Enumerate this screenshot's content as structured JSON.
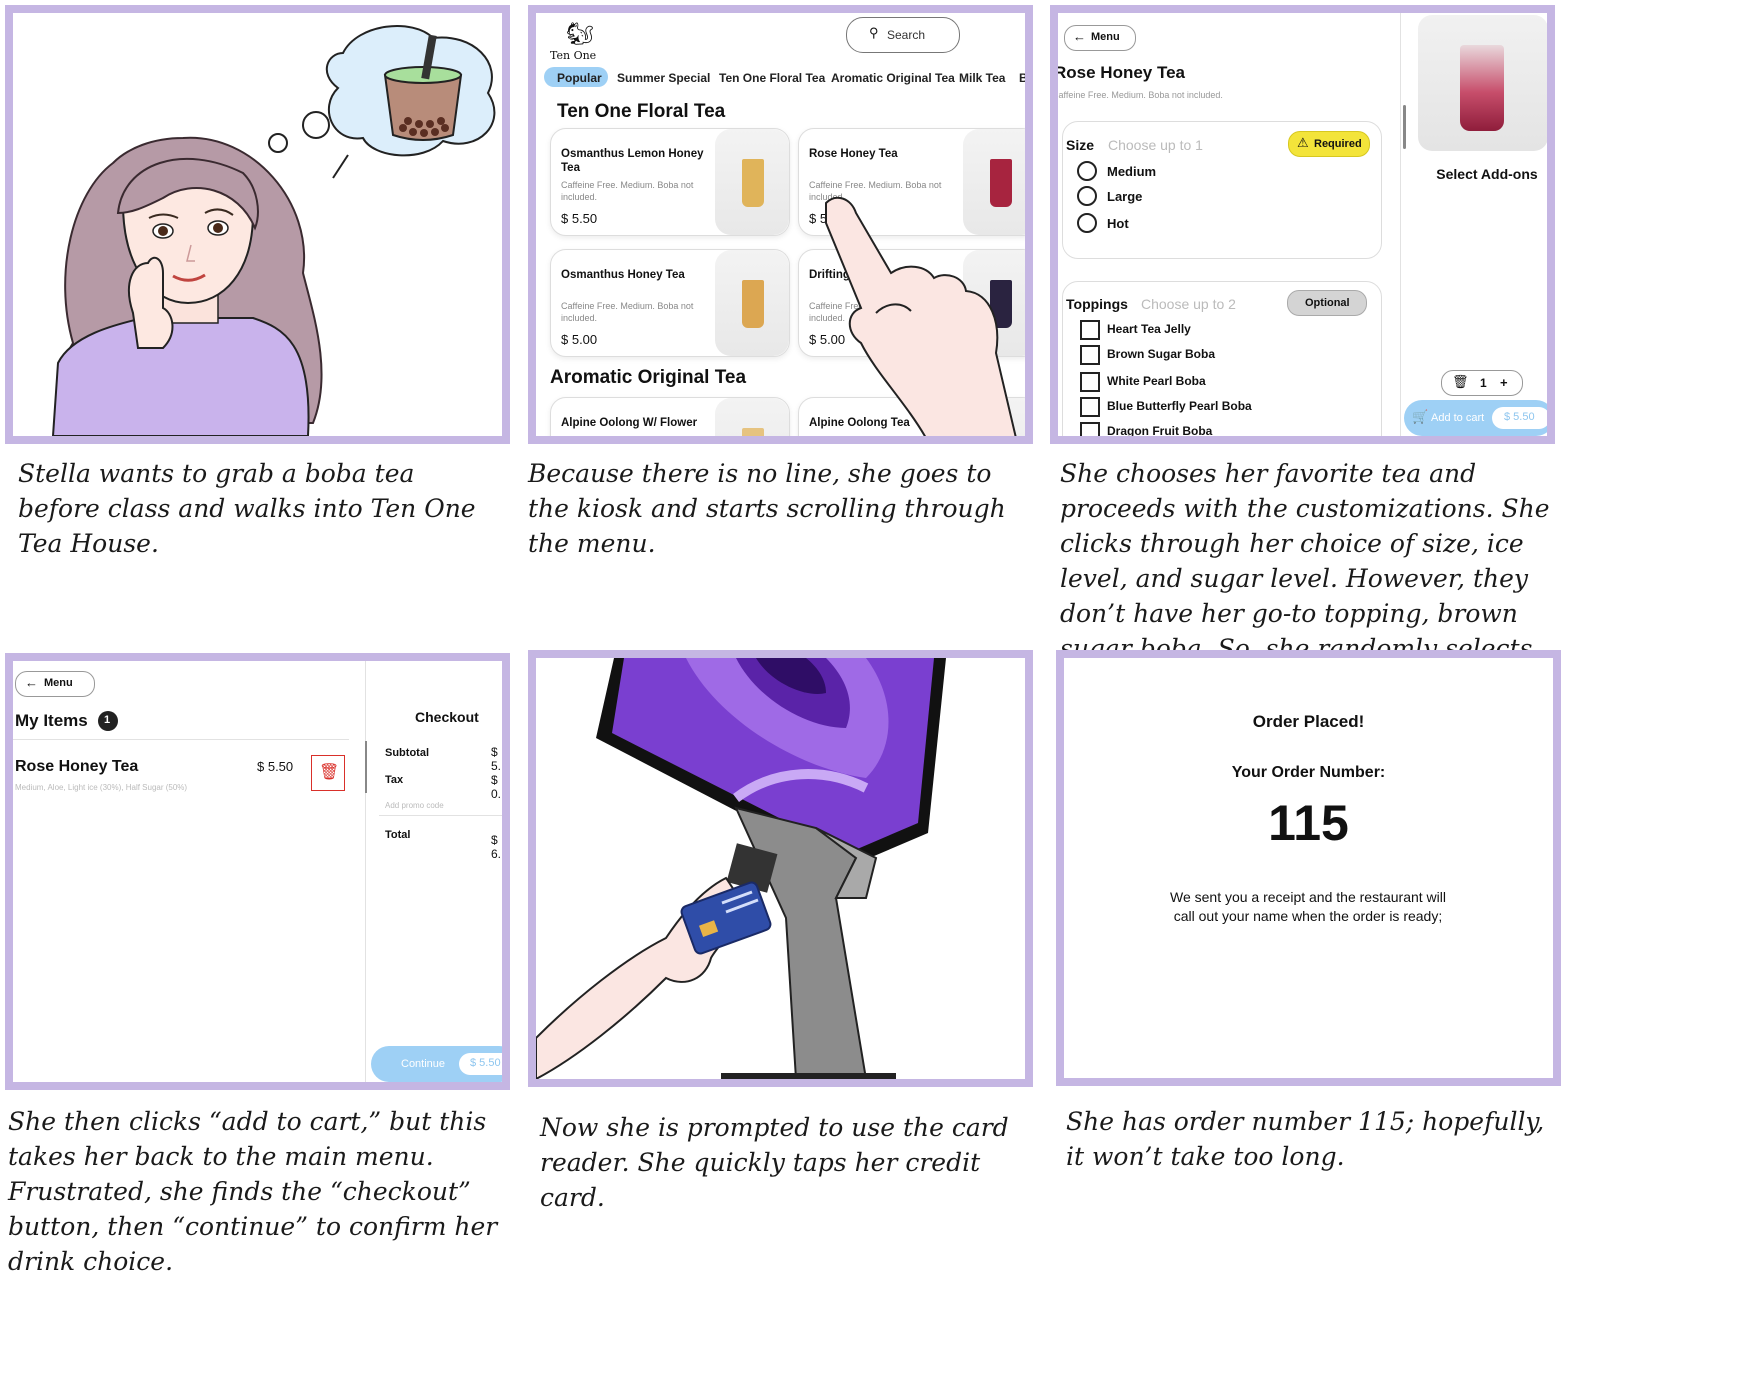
{
  "captions": [
    "Stella wants to grab a boba tea before class and walks into Ten One Tea House.",
    "Because there is no line, she goes to the kiosk and starts scrolling through the menu.",
    "She chooses her favorite tea and proceeds with the customizations. She clicks through her choice of size, ice level, and sugar level. However, they don’t have her go-to topping, brown sugar boba. So, she randomly selects another one as she is running late for her class.",
    "She then clicks “add to cart,” but this takes her back to the main menu. Frustrated, she finds the “checkout” button, then “continue” to confirm her drink choice.",
    "Now she is prompted to use the card reader. She quickly taps her credit card.",
    "She has order number 115; hopefully, it won’t take too long."
  ],
  "menu_screen": {
    "brand": "Ten One",
    "search_placeholder": "Search",
    "tabs": [
      "Popular",
      "Summer Special",
      "Ten One Floral Tea",
      "Aromatic Original Tea",
      "Milk Tea",
      "B"
    ],
    "section1_title": "Ten One Floral Tea",
    "section2_title": "Aromatic Original Tea",
    "items": [
      {
        "name": "Osmanthus Lemon Honey Tea",
        "desc": "Caffeine Free. Medium. Boba not included.",
        "price": "$ 5.50",
        "color": "#e0b45a"
      },
      {
        "name": "Rose Honey Tea",
        "desc": "Caffeine Free. Medium. Boba not included.",
        "price": "$ 5.50",
        "color": "#a7243f"
      },
      {
        "name": "Osmanthus  Honey Tea",
        "desc": "Caffeine Free. Medium. Boba not included.",
        "price": "$ 5.00",
        "color": "#dca752"
      },
      {
        "name": "Drifting in Dreams",
        "desc": "Caffeine Free. Medium. Boba not included.",
        "price": "$ 5.00",
        "color": "#2a2340"
      },
      {
        "name": "Alpine Oolong W/ Flower",
        "desc": "",
        "price": "",
        "color": "#e6c380"
      },
      {
        "name": "Alpine Oolong Tea",
        "desc": "",
        "price": "",
        "color": "#e2c27a"
      }
    ]
  },
  "detail_screen": {
    "back_label": "Menu",
    "title": "Rose Honey Tea",
    "subtitle": "Caffeine Free. Medium. Boba not included.",
    "size_label": "Size",
    "size_hint": "Choose up to 1",
    "required_badge": "Required",
    "size_options": [
      "Medium",
      "Large",
      "Hot"
    ],
    "toppings_label": "Toppings",
    "toppings_hint": "Choose up to 2",
    "optional_badge": "Optional",
    "toppings": [
      "Heart Tea Jelly",
      "Brown Sugar Boba",
      "White Pearl Boba",
      "Blue Butterfly Pearl Boba",
      "Dragon Fruit Boba"
    ],
    "addons_label": "Select Add-ons",
    "quantity": "1",
    "plus": "+",
    "add_to_cart": "Add to cart",
    "cart_price": "$ 5.50"
  },
  "cart_screen": {
    "back_label": "Menu",
    "my_items": "My Items",
    "item_count": "1",
    "item_name": "Rose Honey Tea",
    "item_price": "$ 5.50",
    "item_details": "Medium, Aloe, Light ice (30%), Half Sugar (50%)",
    "checkout_title": "Checkout",
    "subtotal_label": "Subtotal",
    "subtotal_value": "$ 5.",
    "tax_label": "Tax",
    "tax_value": "$ 0.",
    "promo_placeholder": "Add promo code",
    "total_label": "Total",
    "total_value": "$ 6.",
    "continue_label": "Continue",
    "continue_price": "$ 5.50"
  },
  "confirm_screen": {
    "heading": "Order Placed!",
    "order_label": "Your Order Number:",
    "order_number": "115",
    "message": "We sent you a receipt and the restaurant will call out your name when the order is ready;"
  },
  "colors": {
    "frame": "#c5b6e3",
    "accent_blue": "#9ed0f5",
    "required_yellow": "#f3e43a",
    "delete_red": "#d9302a",
    "shirt_purple": "#c9b3ec",
    "kiosk_purple": "#7a3fd0"
  }
}
